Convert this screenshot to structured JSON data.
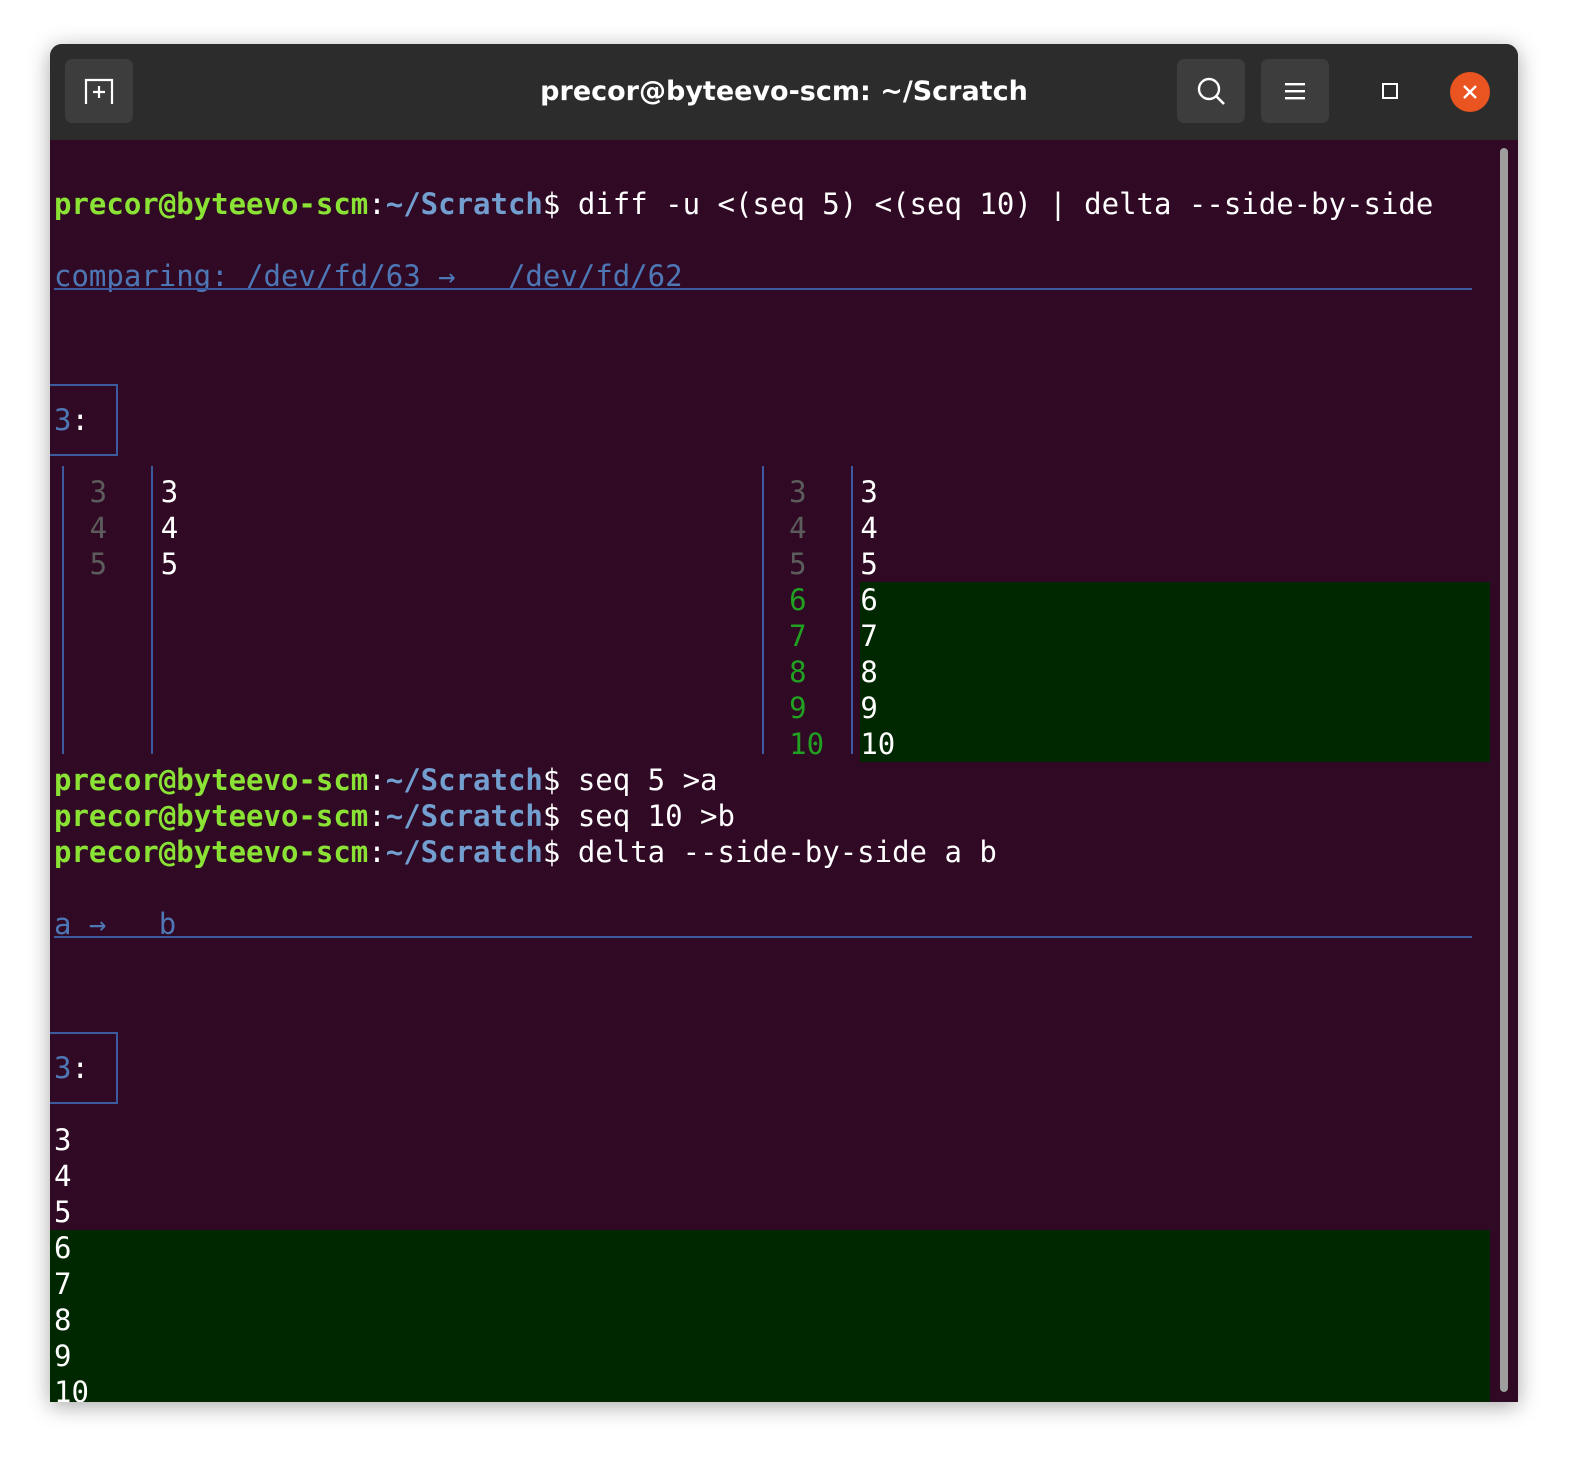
{
  "window": {
    "title": "precor@byteevo-scm: ~/Scratch",
    "icons": {
      "new_tab": "new-tab-icon",
      "search": "search-icon",
      "menu": "hamburger-menu-icon",
      "maximize": "maximize-icon",
      "close": "close-icon"
    }
  },
  "prompt": {
    "user_host": "precor@byteevo-scm",
    "colon": ":",
    "path": "~/Scratch",
    "dollar": "$"
  },
  "commands": [
    "diff -u <(seq 5) <(seq 10) | delta --side-by-side",
    "seq 5 >a",
    "seq 10 >b",
    "delta --side-by-side a b"
  ],
  "diff1": {
    "header": "comparing: /dev/fd/63 →   /dev/fd/62",
    "hunk": {
      "num": "3",
      "colon": ":"
    },
    "left": [
      {
        "num": "3",
        "text": "3"
      },
      {
        "num": "4",
        "text": "4"
      },
      {
        "num": "5",
        "text": "5"
      }
    ],
    "right": [
      {
        "num": "3",
        "text": "3",
        "added": false
      },
      {
        "num": "4",
        "text": "4",
        "added": false
      },
      {
        "num": "5",
        "text": "5",
        "added": false
      },
      {
        "num": "6",
        "text": "6",
        "added": true
      },
      {
        "num": "7",
        "text": "7",
        "added": true
      },
      {
        "num": "8",
        "text": "8",
        "added": true
      },
      {
        "num": "9",
        "text": "9",
        "added": true
      },
      {
        "num": "10",
        "text": "10",
        "added": true
      }
    ]
  },
  "diff2": {
    "header": "a →   b",
    "hunk": {
      "num": "3",
      "colon": ":"
    },
    "lines": [
      {
        "text": "3",
        "added": false
      },
      {
        "text": "4",
        "added": false
      },
      {
        "text": "5",
        "added": false
      },
      {
        "text": "6",
        "added": true
      },
      {
        "text": "7",
        "added": true
      },
      {
        "text": "8",
        "added": true
      },
      {
        "text": "9",
        "added": true
      },
      {
        "text": "10",
        "added": true
      }
    ]
  },
  "colors": {
    "background": "#300a24",
    "prompt_user": "#8ae234",
    "prompt_path": "#729fcf",
    "added_bg": "#002800",
    "added_num": "#21a121",
    "rule": "#3c5aa0",
    "close": "#e95420"
  }
}
